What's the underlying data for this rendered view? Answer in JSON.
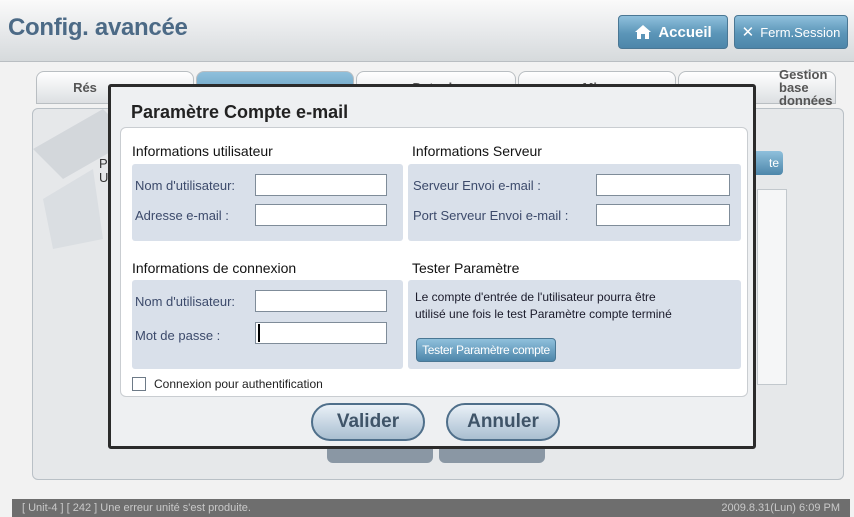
{
  "header": {
    "title": "Config. avancée",
    "home_label": "Accueil",
    "logout_label": "Ferm.Session"
  },
  "tabs": [
    {
      "label": "Rés"
    },
    {
      "label": ""
    },
    {
      "label": "Date de"
    },
    {
      "label": "Mise"
    },
    {
      "label": "Gestion base données"
    }
  ],
  "background": {
    "side_label_1": "P",
    "side_label_2": "U",
    "right_button": "te"
  },
  "dialog": {
    "title": "Paramètre Compte e-mail",
    "user_info": {
      "heading": "Informations utilisateur",
      "username_label": "Nom d'utilisateur:",
      "username_value": "",
      "email_label": "Adresse e-mail  :",
      "email_value": ""
    },
    "server_info": {
      "heading": "Informations Serveur",
      "server_label": "Serveur Envoi e-mail   :",
      "server_value": "",
      "port_label": "Port Serveur Envoi e-mail :",
      "port_value": ""
    },
    "login_info": {
      "heading": "Informations de connexion",
      "username_label": "Nom d'utilisateur:",
      "username_value": "",
      "password_label": "Mot de passe    :",
      "password_value": ""
    },
    "test": {
      "heading": "Tester Paramètre",
      "note_line1": "Le compte d'entrée de l'utilisateur pourra être",
      "note_line2": "utilisé une fois le test Paramètre compte terminé",
      "button_label": "Tester Paramètre compte"
    },
    "auth_checkbox_label": "Connexion pour authentification",
    "auth_checked": false,
    "validate_label": "Valider",
    "cancel_label": "Annuler"
  },
  "status_bar": {
    "message": "[ Unit-4 ] [ 242 ] Une erreur unité s'est produite.",
    "datetime": "2009.8.31(Lun)  6:09 PM"
  },
  "colors": {
    "accent": "#5b95b8",
    "title": "#4c6a86",
    "section_bg": "#d9e0ea"
  }
}
